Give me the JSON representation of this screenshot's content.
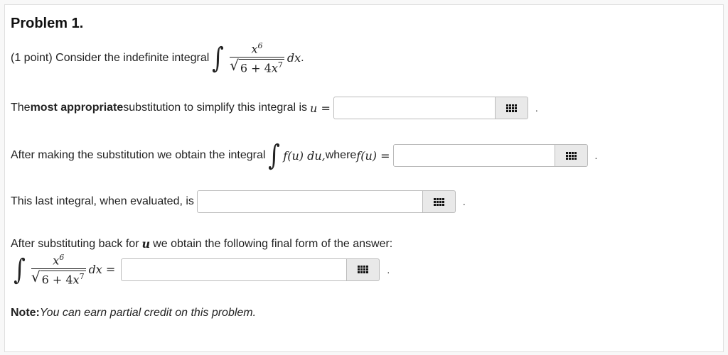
{
  "problem_title": "Problem 1.",
  "intro": {
    "text": "(1 point) Consider the indefinite integral",
    "integrand_numerator": "x",
    "numerator_exp": "6",
    "sqrt_const": "6 + 4",
    "sqrt_var": "x",
    "sqrt_exp": "7",
    "dx": "dx",
    "end": "."
  },
  "q1": {
    "prefix": "The ",
    "bold": "most appropriate",
    "suffix": " substitution to simplify this integral is ",
    "math": "u =",
    "end": "."
  },
  "q2": {
    "prefix": "After making the substitution we obtain the integral ",
    "integral_expr": "f(u) du,",
    "where": " where ",
    "math": "f(u) =",
    "end": "."
  },
  "q3": {
    "prefix": "This last integral, when evaluated, is",
    "end": "."
  },
  "q4": {
    "prefix": "After substituting back for ",
    "var": "u",
    "suffix": " we obtain the following final form of the answer:",
    "dx_eq": "dx =",
    "end": "."
  },
  "note": {
    "label": "Note:",
    "text": " You can earn partial credit on this problem."
  },
  "icons": {
    "answer_button": "grid-palette-icon"
  }
}
